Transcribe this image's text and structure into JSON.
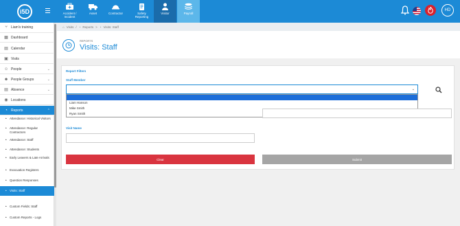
{
  "logo": {
    "text": "i5D"
  },
  "top_nav": [
    {
      "label": "Accident / Incident",
      "icon": "medical-kit-icon"
    },
    {
      "label": "Asset",
      "icon": "truck-icon"
    },
    {
      "label": "Contractor",
      "icon": "hard-hat-icon"
    },
    {
      "label": "Safety Reporting",
      "icon": "clipboard-icon"
    },
    {
      "label": "Visitor",
      "icon": "person-icon"
    },
    {
      "label": "Payroll",
      "icon": "stack-icon"
    }
  ],
  "user": {
    "initials": "HD"
  },
  "sidebar": {
    "org": "Liam's training",
    "items": [
      {
        "label": "Dashboard",
        "icon": "▦"
      },
      {
        "label": "Calendar",
        "icon": "▤"
      },
      {
        "label": "Visits",
        "icon": "▣"
      },
      {
        "label": "People",
        "icon": "☺",
        "chev": "⌄"
      },
      {
        "label": "People Groups",
        "icon": "☻",
        "chev": "⌄"
      },
      {
        "label": "Absence",
        "icon": "▤",
        "chev": "⌄"
      },
      {
        "label": "Locations",
        "icon": "◉"
      },
      {
        "label": "Reports",
        "icon": "◔",
        "chev": "⌃"
      }
    ],
    "subitems": [
      {
        "label": "Attendance: Historical Visitors"
      },
      {
        "label": "Attendance: Regular Contractors"
      },
      {
        "label": "Attendance: Staff"
      },
      {
        "label": "Attendance: Students"
      },
      {
        "label": "Early Leavers & Late Arrivals"
      },
      {
        "label": "Evacuation Registers"
      },
      {
        "label": "Question Responses"
      },
      {
        "label": "Visits: Staff"
      },
      {
        "label": "Custom Fields: Staff"
      },
      {
        "label": "Custom Reports - Logs"
      }
    ]
  },
  "breadcrumb": {
    "items": [
      "Visits",
      "Reports",
      "Visits: Staff"
    ]
  },
  "page": {
    "section": "REPORTS",
    "title": "Visits: Staff"
  },
  "filters": {
    "heading": "Report Filters",
    "staff_label": "Staff Member",
    "staff_options": [
      "Liam Hanson",
      "Mike Smith",
      "Ryan Smith"
    ],
    "visit_name_label": "Visit Name",
    "clear_label": "Clear",
    "submit_label": "Submit"
  }
}
